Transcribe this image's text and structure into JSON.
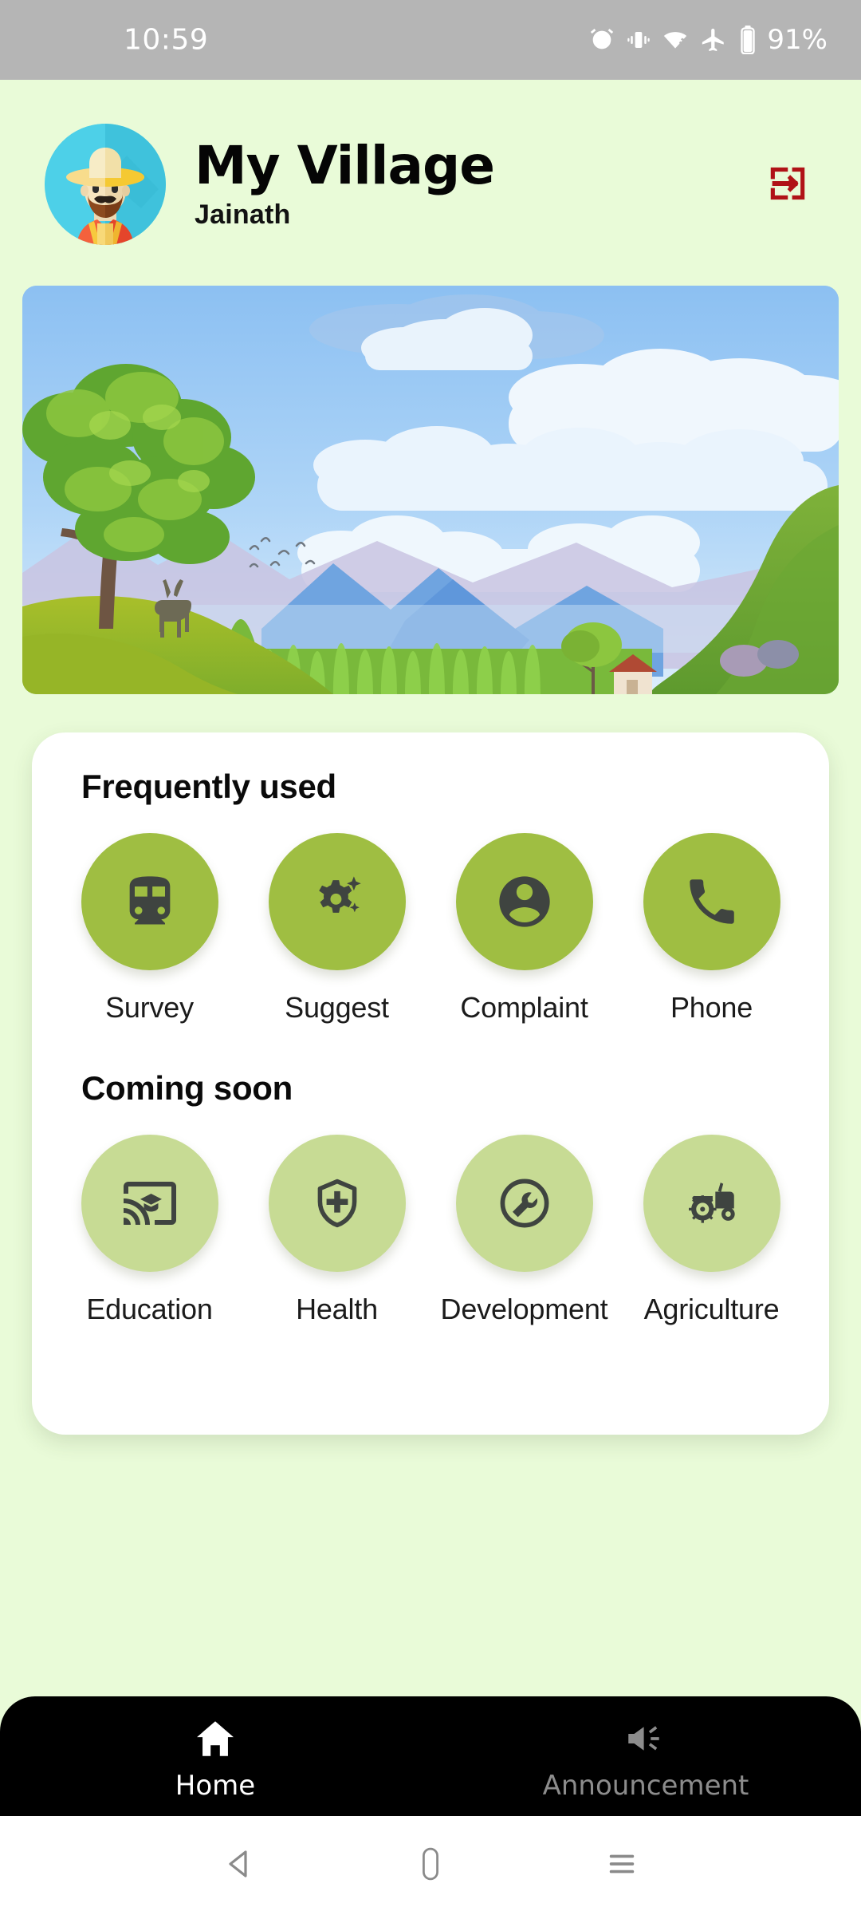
{
  "status_bar": {
    "time": "10:59",
    "battery_percent": "91%",
    "icons": [
      "alarm-icon",
      "vibrate-icon",
      "wifi-icon",
      "airplane-mode-icon",
      "battery-icon"
    ]
  },
  "header": {
    "title": "My Village",
    "subtitle": "Jainath",
    "avatar": "farmer-avatar",
    "logout_icon": "logout-icon",
    "logout_color": "#B01217"
  },
  "banner": {
    "name": "village-landscape-illustration"
  },
  "sections": [
    {
      "title": "Frequently used",
      "style": "primary",
      "circle_color": "#9FBE42",
      "items": [
        {
          "label": "Survey",
          "icon": "train-icon"
        },
        {
          "label": "Suggest",
          "icon": "settings-suggest-icon"
        },
        {
          "label": "Complaint",
          "icon": "account-circle-icon"
        },
        {
          "label": "Phone",
          "icon": "phone-icon"
        }
      ]
    },
    {
      "title": "Coming soon",
      "style": "soon",
      "circle_color": "#C7DB94",
      "items": [
        {
          "label": "Education",
          "icon": "cast-for-education-icon"
        },
        {
          "label": "Health",
          "icon": "health-shield-icon"
        },
        {
          "label": "Development",
          "icon": "build-circle-icon"
        },
        {
          "label": "Agriculture",
          "icon": "tractor-icon"
        }
      ]
    }
  ],
  "bottom_nav": {
    "items": [
      {
        "label": "Home",
        "icon": "home-icon",
        "active": true
      },
      {
        "label": "Announcement",
        "icon": "campaign-icon",
        "active": false
      }
    ]
  },
  "system_nav": {
    "back": "back-triangle-icon",
    "home": "home-pill-icon",
    "recents": "recents-menu-icon"
  },
  "theme": {
    "background": "#E9FBD8",
    "card": "#FFFFFF",
    "accent": "#9FBE42",
    "accent_light": "#C7DB94",
    "nav_bar": "#000000"
  }
}
